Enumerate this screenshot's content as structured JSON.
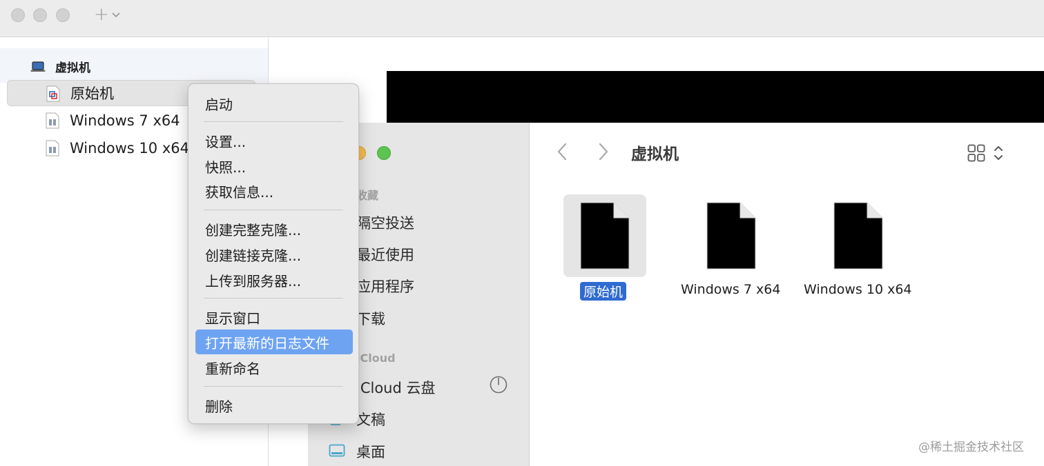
{
  "colors": {
    "accent_selection": "#2f6bd1",
    "menu_highlight": "#6ea3f2",
    "traffic_light_inactive": "#d1d1d1",
    "traffic_yellow": "#f5bd4f",
    "traffic_green": "#5dc451"
  },
  "toolbar": {
    "add_icon": "plus-icon",
    "add_menu_icon": "chevron-down-icon"
  },
  "library": {
    "header": {
      "label": "虚拟机",
      "icon": "laptop-icon"
    },
    "items": [
      {
        "label": "原始机",
        "icon": "vm-running-icon",
        "selected": true
      },
      {
        "label": "Windows 7 x64",
        "icon": "vm-document-icon",
        "selected": false
      },
      {
        "label": "Windows 10 x64",
        "icon": "vm-document-icon",
        "selected": false
      }
    ]
  },
  "context_menu": {
    "groups": [
      [
        {
          "label": "启动"
        }
      ],
      [
        {
          "label": "设置..."
        },
        {
          "label": "快照..."
        },
        {
          "label": "获取信息..."
        }
      ],
      [
        {
          "label": "创建完整克隆..."
        },
        {
          "label": "创建链接克隆..."
        },
        {
          "label": "上传到服务器..."
        }
      ],
      [
        {
          "label": "显示窗口"
        },
        {
          "label": "打开最新的日志文件",
          "highlighted": true
        },
        {
          "label": "重新命名"
        }
      ],
      [
        {
          "label": "删除"
        }
      ]
    ]
  },
  "finder": {
    "title": "虚拟机",
    "sidebar": {
      "favorites_header": "收藏",
      "favorites": [
        {
          "label": "隔空投送",
          "icon": "airdrop-icon"
        },
        {
          "label": "最近使用",
          "icon": "clock-icon"
        },
        {
          "label": "应用程序",
          "icon": "applications-icon"
        },
        {
          "label": "下载",
          "icon": "download-icon"
        }
      ],
      "icloud_header": "iCloud",
      "icloud": [
        {
          "label": "iCloud 云盘",
          "icon": "cloud-icon"
        },
        {
          "label": "文稿",
          "icon": "document-icon"
        },
        {
          "label": "桌面",
          "icon": "desktop-icon"
        }
      ]
    },
    "files": [
      {
        "name": "原始机",
        "selected": true
      },
      {
        "name": "Windows 7 x64",
        "selected": false
      },
      {
        "name": "Windows 10 x64",
        "selected": false
      }
    ]
  },
  "watermark": "@稀土掘金技术社区"
}
